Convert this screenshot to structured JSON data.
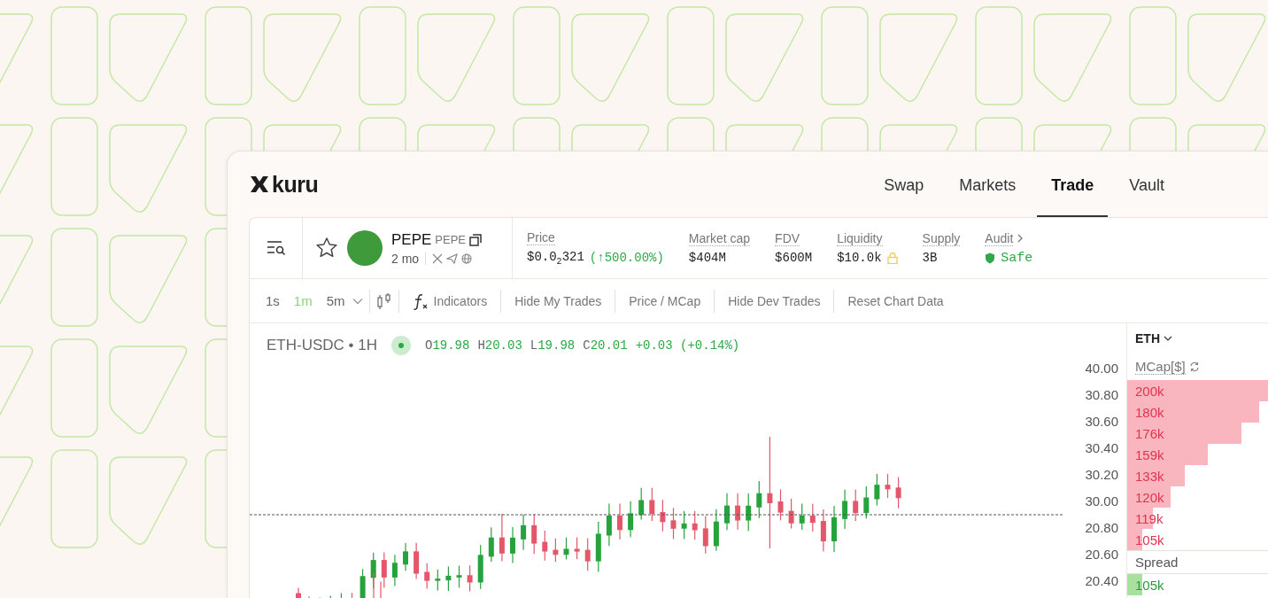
{
  "header": {
    "logo_text": "kuru",
    "nav": [
      {
        "label": "Swap",
        "selected": false
      },
      {
        "label": "Markets",
        "selected": false
      },
      {
        "label": "Trade",
        "selected": true
      },
      {
        "label": "Vault",
        "selected": false
      }
    ]
  },
  "token": {
    "name": "PEPE",
    "ticker": "PEPE",
    "age": "2 mo"
  },
  "stats": [
    {
      "kind": "price",
      "label": "Price",
      "value": "$0.0$_{2}$321",
      "change": "(↑500.00%)"
    },
    {
      "kind": "plain",
      "label": "Market cap",
      "value": "$404M"
    },
    {
      "kind": "plain",
      "label": "FDV",
      "value": "$600M"
    },
    {
      "kind": "locked",
      "label": "Liquidity",
      "value": "$10.0k"
    },
    {
      "kind": "plain",
      "label": "Supply",
      "value": "3B"
    },
    {
      "kind": "audit",
      "label": "Audit",
      "value": "Safe"
    }
  ],
  "toolbar": {
    "timeframes": [
      {
        "label": "1s",
        "selected": false
      },
      {
        "label": "1m",
        "selected": true
      },
      {
        "label": "5m",
        "selected": false
      }
    ],
    "buttons": [
      {
        "kind": "indicators",
        "label": "Indicators"
      },
      {
        "kind": "text",
        "label": "Hide My Trades"
      },
      {
        "kind": "text",
        "label": "Price / MCap"
      },
      {
        "kind": "text",
        "label": "Hide Dev Trades"
      },
      {
        "kind": "text",
        "label": "Reset Chart Data"
      }
    ]
  },
  "chart": {
    "symbol": "ETH-USDC • 1H",
    "ohlc": [
      {
        "label": "O",
        "value": "19.98"
      },
      {
        "label": "H",
        "value": "20.03"
      },
      {
        "label": "L",
        "value": "19.98"
      },
      {
        "label": "C",
        "value": "20.01"
      }
    ],
    "change": "+0.03 (+0.14%)",
    "price_axis": [
      "40.00",
      "30.80",
      "30.60",
      "30.40",
      "30.20",
      "30.00",
      "20.80",
      "20.60",
      "20.40"
    ]
  },
  "order_book": {
    "currency": "ETH",
    "column": "MCap[$]",
    "asks": [
      {
        "value": "200k"
      },
      {
        "value": "180k"
      },
      {
        "value": "176k"
      },
      {
        "value": "159k"
      },
      {
        "value": "133k"
      },
      {
        "value": "120k"
      },
      {
        "value": "119k"
      },
      {
        "value": "105k"
      }
    ],
    "spread_label": "Spread",
    "bids": [
      {
        "value": "105k"
      }
    ]
  }
}
